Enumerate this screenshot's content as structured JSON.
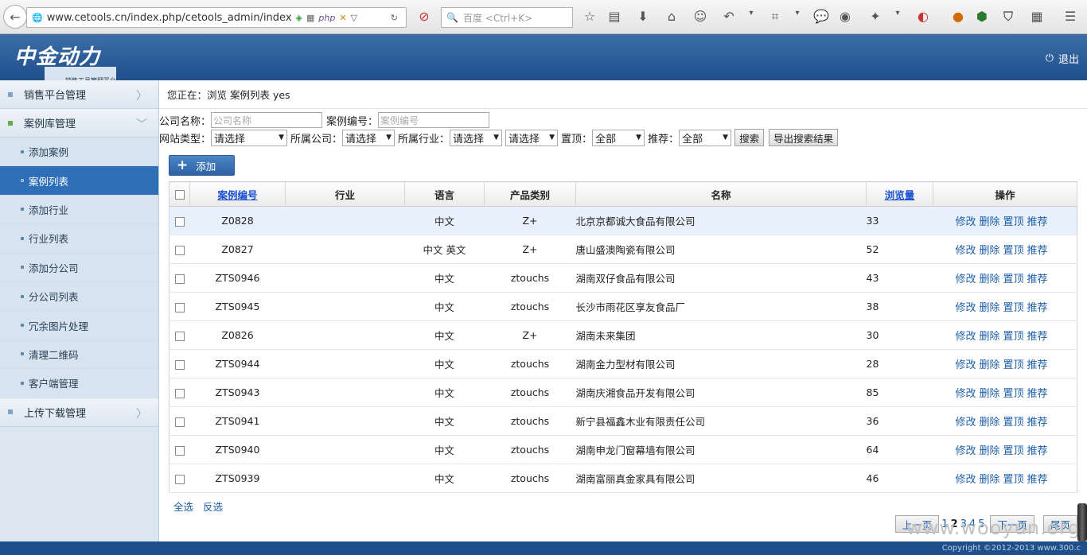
{
  "browser": {
    "url": "www.cetools.cn/index.php/cetools_admin/index",
    "search_placeholder": "百度 <Ctrl+K>"
  },
  "header": {
    "brand": "中金动力",
    "subtitle": "销售工具管理平台",
    "logout": "退出"
  },
  "sidebar": {
    "sections": [
      {
        "label": "销售平台管理"
      },
      {
        "label": "案例库管理"
      },
      {
        "label": "上传下载管理"
      }
    ],
    "items": [
      {
        "label": "添加案例"
      },
      {
        "label": "案例列表"
      },
      {
        "label": "添加行业"
      },
      {
        "label": "行业列表"
      },
      {
        "label": "添加分公司"
      },
      {
        "label": "分公司列表"
      },
      {
        "label": "冗余图片处理"
      },
      {
        "label": "清理二维码"
      },
      {
        "label": "客户端管理"
      }
    ]
  },
  "breadcrumb": "您正在：浏览 案例列表 yes",
  "filters": {
    "company_label": "公司名称：",
    "company_placeholder": "公司名称",
    "case_no_label": "案例编号：",
    "case_no_placeholder": "案例编号",
    "site_type_label": "网站类型：",
    "site_type_value": "请选择",
    "branch_label": "所属公司：",
    "branch_value": "请选择",
    "industry_label": "所属行业：",
    "industry_value": "请选择",
    "industry2_value": "请选择",
    "top_label": "置顶：",
    "top_value": "全部",
    "recommend_label": "推荐：",
    "recommend_value": "全部",
    "search_button": "搜索",
    "export_button": "导出搜索结果"
  },
  "add_button": "添加",
  "table": {
    "headers": [
      "案例编号",
      "行业",
      "语言",
      "产品类别",
      "名称",
      "浏览量",
      "操作"
    ],
    "ops": [
      "修改",
      "删除",
      "置顶",
      "推荐"
    ],
    "rows": [
      {
        "id": "Z0828",
        "industry": "",
        "lang": "中文",
        "cat": "Z+",
        "name": "北京京都诚大食品有限公司",
        "views": "33"
      },
      {
        "id": "Z0827",
        "industry": "",
        "lang": "中文 英文",
        "cat": "Z+",
        "name": "唐山盛澳陶瓷有限公司",
        "views": "52"
      },
      {
        "id": "ZTS0946",
        "industry": "",
        "lang": "中文",
        "cat": "ztouchs",
        "name": "湖南双仔食品有限公司",
        "views": "43"
      },
      {
        "id": "ZTS0945",
        "industry": "",
        "lang": "中文",
        "cat": "ztouchs",
        "name": "长沙市雨花区享友食品厂",
        "views": "38"
      },
      {
        "id": "Z0826",
        "industry": "",
        "lang": "中文",
        "cat": "Z+",
        "name": "湖南未来集团",
        "views": "30"
      },
      {
        "id": "ZTS0944",
        "industry": "",
        "lang": "中文",
        "cat": "ztouchs",
        "name": "湖南金力型材有限公司",
        "views": "28"
      },
      {
        "id": "ZTS0943",
        "industry": "",
        "lang": "中文",
        "cat": "ztouchs",
        "name": "湖南庆湘食品开发有限公司",
        "views": "85"
      },
      {
        "id": "ZTS0941",
        "industry": "",
        "lang": "中文",
        "cat": "ztouchs",
        "name": "新宁县福鑫木业有限责任公司",
        "views": "36"
      },
      {
        "id": "ZTS0940",
        "industry": "",
        "lang": "中文",
        "cat": "ztouchs",
        "name": "湖南申龙门窗幕墙有限公司",
        "views": "64"
      },
      {
        "id": "ZTS0939",
        "industry": "",
        "lang": "中文",
        "cat": "ztouchs",
        "name": "湖南富丽真金家具有限公司",
        "views": "46"
      }
    ]
  },
  "select_all": "全选",
  "invert_select": "反选",
  "pager": {
    "prev": "上一页",
    "pages": [
      "1",
      "2",
      "3",
      "4",
      "5"
    ],
    "current": "2",
    "next": "下一页",
    "last": "尾页"
  },
  "footer": "Copyright ©2012-2013 www.300.c",
  "watermark": "www.wooyun.org"
}
